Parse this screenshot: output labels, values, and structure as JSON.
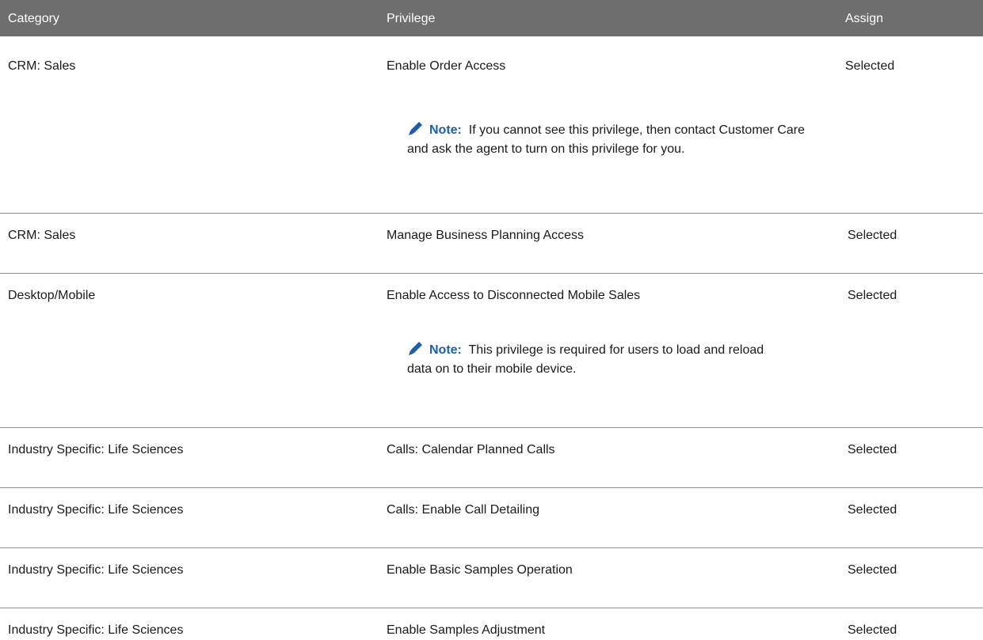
{
  "table": {
    "headers": {
      "category": "Category",
      "privilege": "Privilege",
      "assign": "Assign"
    },
    "rows": [
      {
        "category": "CRM: Sales",
        "privilege": "Enable Order Access",
        "assign": "Selected",
        "note": {
          "label": "Note:",
          "text": "If you cannot see this privilege, then contact Customer Care and ask the agent to turn on this privilege for you."
        }
      },
      {
        "category": "CRM: Sales",
        "privilege": "Manage Business Planning Access",
        "assign": "Selected"
      },
      {
        "category": "Desktop/Mobile",
        "privilege": "Enable Access to Disconnected Mobile Sales",
        "assign": "Selected",
        "note": {
          "label": "Note:",
          "text": "This privilege is required for users to load and reload data on to their mobile device."
        }
      },
      {
        "category": "Industry Specific: Life Sciences",
        "privilege": "Calls: Calendar Planned Calls",
        "assign": "Selected"
      },
      {
        "category": "Industry Specific: Life Sciences",
        "privilege": "Calls: Enable Call Detailing",
        "assign": "Selected"
      },
      {
        "category": "Industry Specific: Life Sciences",
        "privilege": "Enable Basic Samples Operation",
        "assign": "Selected"
      },
      {
        "category": "Industry Specific: Life Sciences",
        "privilege": "Enable Samples Adjustment",
        "assign": "Selected"
      }
    ]
  },
  "icons": {
    "note_icon": "pencil-icon",
    "note_icon_color": "#1f5fa8"
  },
  "colors": {
    "header_bg": "#6e6e6e",
    "note_label": "#1f5fa8"
  }
}
